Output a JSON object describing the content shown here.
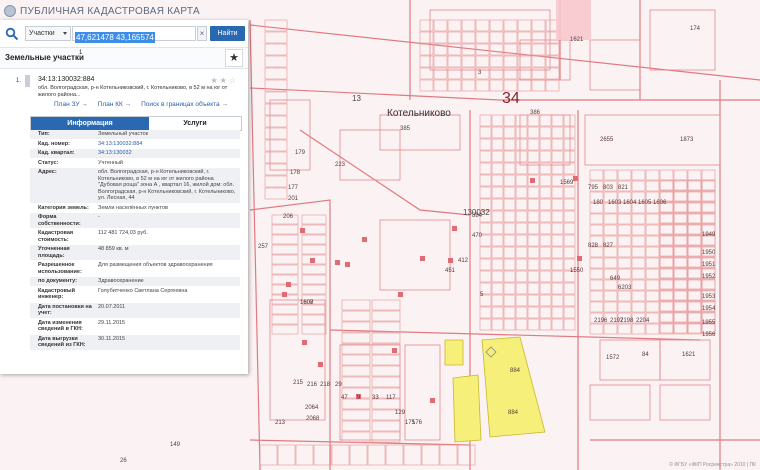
{
  "app": {
    "title": "ПУБЛИЧНАЯ КАДАСТРОВАЯ КАРТА"
  },
  "search": {
    "type_label": "Участки",
    "query": "47,621478 43,165574",
    "find_label": "Найти",
    "clear_label": "×"
  },
  "section": {
    "title": "Земельные участки",
    "count": "1",
    "star": "★"
  },
  "result": {
    "number": "1.",
    "cadastral": "34:13:130032:884",
    "rating": "★★☆",
    "address": "обл. Волгоградская, р-н Котельниковский, г. Котельниково, в 52 м на юг от жилого района...",
    "links": [
      "План ЗУ →",
      "План КК →",
      "Поиск в границах объекта →"
    ]
  },
  "tabs": {
    "info": "Информация",
    "services": "Услуги"
  },
  "properties": [
    {
      "key": "Тип:",
      "value": "Земельный участок",
      "link": false
    },
    {
      "key": "Кад. номер:",
      "value": "34:13:130032:884",
      "link": true
    },
    {
      "key": "Кад. квартал:",
      "value": "34:13:130032",
      "link": true
    },
    {
      "key": "Статус:",
      "value": "Учтенный",
      "link": false
    },
    {
      "key": "Адрес:",
      "value": "обл. Волгоградская, р-н Котельниковский, г. Котельниково, в 52 м на юг от жилого района \"Дубовая роща\" зона А , квартал 16, жилой дом: обл. Волгоградская, р-н Котельниковский, г. Котельниково, ул. Лесная, 44",
      "link": false
    },
    {
      "key": "Категория земель:",
      "value": "Земли населённых пунктов",
      "link": false
    },
    {
      "key": "Форма собственности:",
      "value": "-",
      "link": false
    },
    {
      "key": "Кадастровая стоимость:",
      "value": "112 481 724,03 руб.",
      "link": false
    },
    {
      "key": "Уточненная площадь:",
      "value": "48 859 кв. м",
      "link": false
    },
    {
      "key": "Разрешенное использование:",
      "value": "Для размещения объектов здравоохранения",
      "link": false
    },
    {
      "key": "по документу:",
      "value": "Здравоохранение",
      "link": false
    },
    {
      "key": "Кадастровый инженер:",
      "value": "Голубитченко Светлана Сергеевна",
      "link": false
    },
    {
      "key": "Дата постановки на учет:",
      "value": "20.07.2011",
      "link": false
    },
    {
      "key": "Дата изменения сведений в ГКН:",
      "value": "29.11.2015",
      "link": false
    },
    {
      "key": "Дата выгрузки сведений из ГКН:",
      "value": "30.11.2015",
      "link": false
    }
  ],
  "map": {
    "district_label": "Котельниково",
    "quarter_label": "34",
    "block_labels": [
      "13",
      "130032"
    ],
    "parcel_numbers": [
      "1621",
      "174",
      "3",
      "386",
      "385",
      "2655",
      "1873",
      "884",
      "884",
      "884",
      "795",
      "803",
      "821",
      "828",
      "827",
      "1949",
      "1950",
      "1951",
      "1952",
      "1953",
      "1954",
      "1955",
      "1956",
      "649",
      "6203",
      "1572",
      "84",
      "1621",
      "2196",
      "2197",
      "2198",
      "2204",
      "1550",
      "1569",
      "257",
      "223",
      "470",
      "412",
      "451",
      "201",
      "206",
      "2064",
      "2068",
      "5",
      "26",
      "149",
      "213",
      "215",
      "216",
      "218",
      "29",
      "47",
      "9",
      "33",
      "117",
      "129",
      "175",
      "176",
      "177",
      "178",
      "179",
      "180",
      "1603",
      "1604",
      "1605",
      "1606",
      "1607",
      "1608"
    ],
    "footer": "© ФГБУ «ФКП Росреестра» 2010 | ПК"
  },
  "colors": {
    "accent": "#2a69b2",
    "parcel_line": "#d9474e",
    "selected": "#f6f07a",
    "map_bg": "#fbf3f3"
  },
  "icons": {
    "search": "search-icon",
    "favorite": "star-icon",
    "marker": "location-marker-icon"
  }
}
